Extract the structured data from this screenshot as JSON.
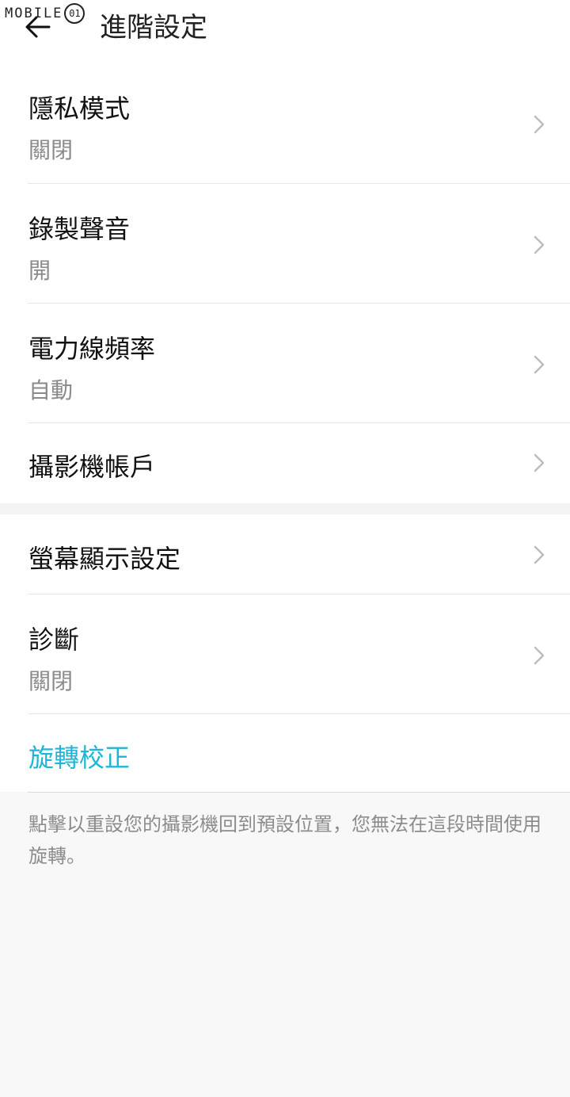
{
  "watermark": {
    "text": "MOBILE",
    "face": "01"
  },
  "header": {
    "title": "進階設定"
  },
  "settings": {
    "privacy": {
      "title": "隱私模式",
      "value": "關閉"
    },
    "record_audio": {
      "title": "錄製聲音",
      "value": "開"
    },
    "power_frequency": {
      "title": "電力線頻率",
      "value": "自動"
    },
    "camera_account": {
      "title": "攝影機帳戶"
    },
    "display_settings": {
      "title": "螢幕顯示設定"
    },
    "diagnostics": {
      "title": "診斷",
      "value": "關閉"
    },
    "rotation_calibration": {
      "title": "旋轉校正"
    }
  },
  "footer": {
    "note": "點擊以重設您的攝影機回到預設位置，您無法在這段時間使用旋轉。"
  },
  "colors": {
    "accent": "#1fb5d6",
    "secondary_text": "#8a8a8a",
    "background": "#f8f8f8"
  },
  "icons": {
    "back": "arrow-left-icon",
    "chevron": "chevron-right-icon"
  }
}
